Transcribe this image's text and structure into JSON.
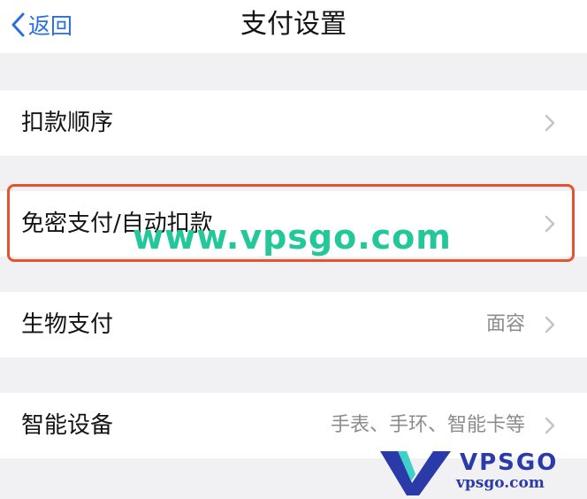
{
  "nav": {
    "back_label": "返回",
    "title": "支付设置"
  },
  "rows": [
    {
      "label": "扣款顺序",
      "value": ""
    },
    {
      "label": "免密支付/自动扣款",
      "value": ""
    },
    {
      "label": "生物支付",
      "value": "面容"
    },
    {
      "label": "智能设备",
      "value": "手表、手环、智能卡等"
    }
  ],
  "watermark": {
    "text": "www.vpsgo.com",
    "logo_word": "VPSGO",
    "logo_url": "vpsgo.com"
  },
  "colors": {
    "accent": "#2a6fde",
    "highlight": "#e5532f",
    "watermark": "#22c79a",
    "logo": "#2a3aa8"
  }
}
